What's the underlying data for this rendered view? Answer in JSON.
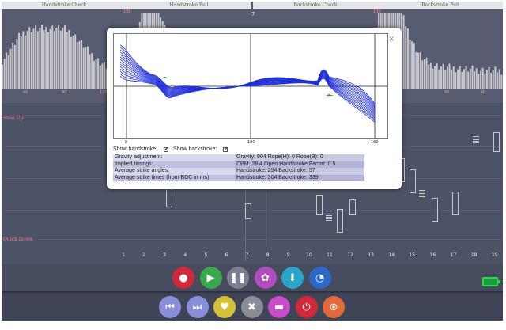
{
  "histograms": [
    {
      "title": "Handstroke Check",
      "scale_label": "",
      "axis": [
        "40",
        "80",
        "120"
      ]
    },
    {
      "title": "Handstroke Pull",
      "scale_label": "100",
      "axis": [
        "",
        "",
        ""
      ]
    },
    {
      "title": "Backstroke Check",
      "scale_label": "",
      "axis": [
        "",
        "",
        ""
      ]
    },
    {
      "title": "Backstroke Pull",
      "scale_label": "100",
      "axis": [
        "",
        "80",
        "40"
      ]
    }
  ],
  "top_marker": "7",
  "strike_chart": {
    "slow_label": "Slow Up",
    "quick_label": "Quick Down",
    "bells": [
      "1",
      "2",
      "3",
      "4",
      "5",
      "6",
      "7",
      "8",
      "9",
      "10",
      "11",
      "12",
      "13",
      "14",
      "15",
      "16",
      "17",
      "18",
      "19"
    ]
  },
  "dialog": {
    "close": "×",
    "axis_ticks": [
      "0",
      "180",
      "180"
    ],
    "show_handstroke": "Show handstroke:",
    "show_backstroke": "Show backstroke:",
    "checkbox_mark": "✔",
    "rows": [
      {
        "label": "Gravity adjustment:",
        "value": "Gravity: 904 Rope(H): 0 Rope(B): 0"
      },
      {
        "label": "Implied timings:",
        "value": "CPM: 28.4 Open Handstroke Factor: 0.5"
      },
      {
        "label": "Average strike angles:",
        "value": "Handstroke: 294 Backstroke: 57"
      },
      {
        "label": "Average strike times (from BDC in ms)",
        "value": "Handstroke: 304 Backstroke: 339"
      }
    ]
  },
  "controls": {
    "row1": [
      {
        "name": "record-button",
        "glyph": "●",
        "color": "#d02a3a"
      },
      {
        "name": "play-button",
        "glyph": "▶",
        "color": "#3aa84a"
      },
      {
        "name": "pause-button",
        "glyph": "❚❚",
        "color": "#7c7f94"
      },
      {
        "name": "settings-button",
        "glyph": "✿",
        "color": "#b04cc0"
      },
      {
        "name": "download-button",
        "glyph": "⬇",
        "color": "#2aa4c8"
      },
      {
        "name": "gauge-button",
        "glyph": "◔",
        "color": "#2b68c8"
      }
    ],
    "row2": [
      {
        "name": "skip-back-button",
        "glyph": "⏮",
        "color": "#8a8dd8"
      },
      {
        "name": "skip-forward-button",
        "glyph": "⏭",
        "color": "#8a8dd8"
      },
      {
        "name": "favorite-button",
        "glyph": "♥",
        "color": "#d6c23a"
      },
      {
        "name": "clear-button",
        "glyph": "✖",
        "color": "#8c8c96"
      },
      {
        "name": "toggle-button",
        "glyph": "▬",
        "color": "#c84cc8"
      },
      {
        "name": "power-button",
        "glyph": "⏻",
        "color": "#d02a3a"
      },
      {
        "name": "help-button",
        "glyph": "⊛",
        "color": "#e26a3a"
      }
    ],
    "battery_color": "#2ad84a"
  }
}
